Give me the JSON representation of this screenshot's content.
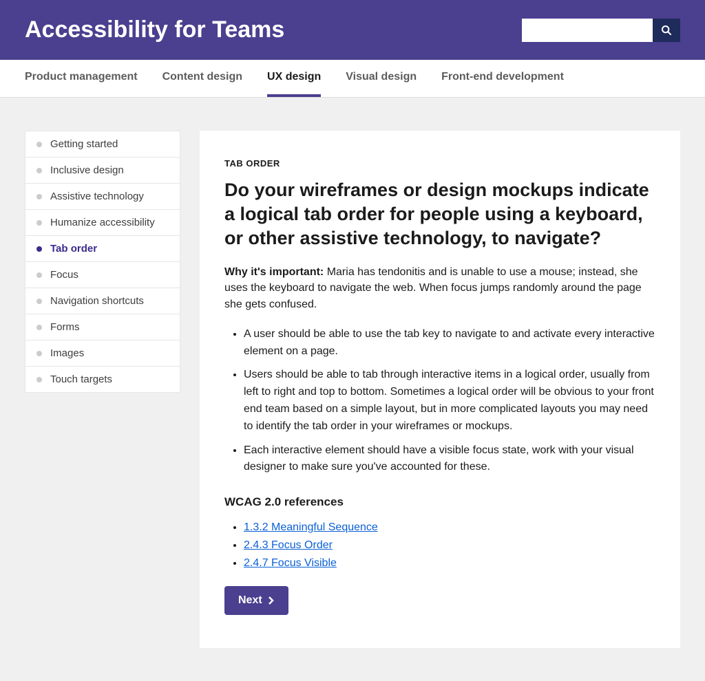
{
  "header": {
    "site_title": "Accessibility for Teams",
    "search_placeholder": ""
  },
  "topnav": {
    "items": [
      {
        "label": "Product management",
        "active": false
      },
      {
        "label": "Content design",
        "active": false
      },
      {
        "label": "UX design",
        "active": true
      },
      {
        "label": "Visual design",
        "active": false
      },
      {
        "label": "Front-end development",
        "active": false
      }
    ]
  },
  "sidebar": {
    "items": [
      {
        "label": "Getting started",
        "active": false
      },
      {
        "label": "Inclusive design",
        "active": false
      },
      {
        "label": "Assistive technology",
        "active": false
      },
      {
        "label": "Humanize accessibility",
        "active": false
      },
      {
        "label": "Tab order",
        "active": true
      },
      {
        "label": "Focus",
        "active": false
      },
      {
        "label": "Navigation shortcuts",
        "active": false
      },
      {
        "label": "Forms",
        "active": false
      },
      {
        "label": "Images",
        "active": false
      },
      {
        "label": "Touch targets",
        "active": false
      }
    ]
  },
  "content": {
    "eyebrow": "TAB ORDER",
    "heading": "Do your wireframes or design mockups indicate a logical tab order for people using a keyboard, or other assistive technology, to navigate?",
    "why_label": "Why it's important:",
    "why_text": "Maria has tendonitis and is unable to use a mouse; instead, she uses the keyboard to navigate the web. When focus jumps randomly around the page she gets confused.",
    "guidelines": [
      "A user should be able to use the tab key to navigate to and activate every interactive element on a page.",
      "Users should be able to tab through interactive items in a logical order, usually from left to right and top to bottom. Sometimes a logical order will be obvious to your front end team based on a simple layout, but in more complicated layouts you may need to identify the tab order in your wireframes or mockups.",
      "Each interactive element should have a visible focus state, work with your visual designer to make sure you've accounted for these."
    ],
    "refs_heading": "WCAG 2.0 references",
    "refs": [
      {
        "label": "1.3.2 Meaningful Sequence"
      },
      {
        "label": "2.4.3 Focus Order"
      },
      {
        "label": "2.4.7 Focus Visible"
      }
    ],
    "next_label": "Next"
  }
}
